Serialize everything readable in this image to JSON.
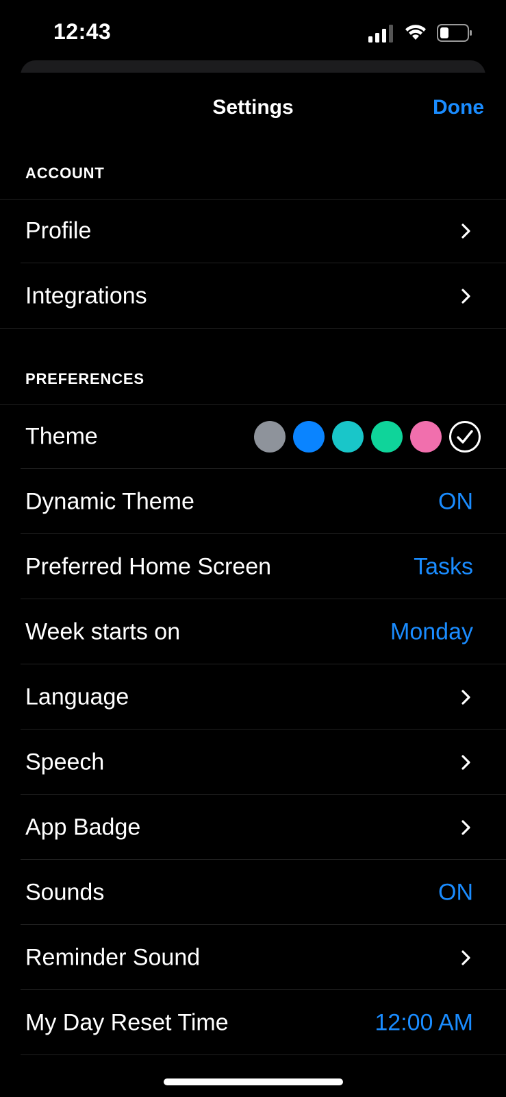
{
  "status_bar": {
    "time": "12:43",
    "icons": [
      "signal-icon",
      "wifi-icon",
      "battery-icon"
    ]
  },
  "nav": {
    "title": "Settings",
    "done_label": "Done"
  },
  "colors": {
    "accent": "#1a8cff",
    "background": "#000000"
  },
  "sections": {
    "account": {
      "header": "ACCOUNT",
      "items": [
        {
          "label": "Profile"
        },
        {
          "label": "Integrations"
        }
      ]
    },
    "preferences": {
      "header": "PREFERENCES",
      "theme": {
        "label": "Theme",
        "swatches": [
          "#8e939b",
          "#0a84ff",
          "#19c6c9",
          "#0fd49a",
          "#f16fad"
        ],
        "selected": "custom"
      },
      "items": [
        {
          "label": "Dynamic Theme",
          "value": "ON"
        },
        {
          "label": "Preferred Home Screen",
          "value": "Tasks"
        },
        {
          "label": "Week starts on",
          "value": "Monday"
        },
        {
          "label": "Language"
        },
        {
          "label": "Speech"
        },
        {
          "label": "App Badge"
        },
        {
          "label": "Sounds",
          "value": "ON"
        },
        {
          "label": "Reminder Sound"
        },
        {
          "label": "My Day Reset Time",
          "value": "12:00 AM"
        }
      ]
    }
  }
}
